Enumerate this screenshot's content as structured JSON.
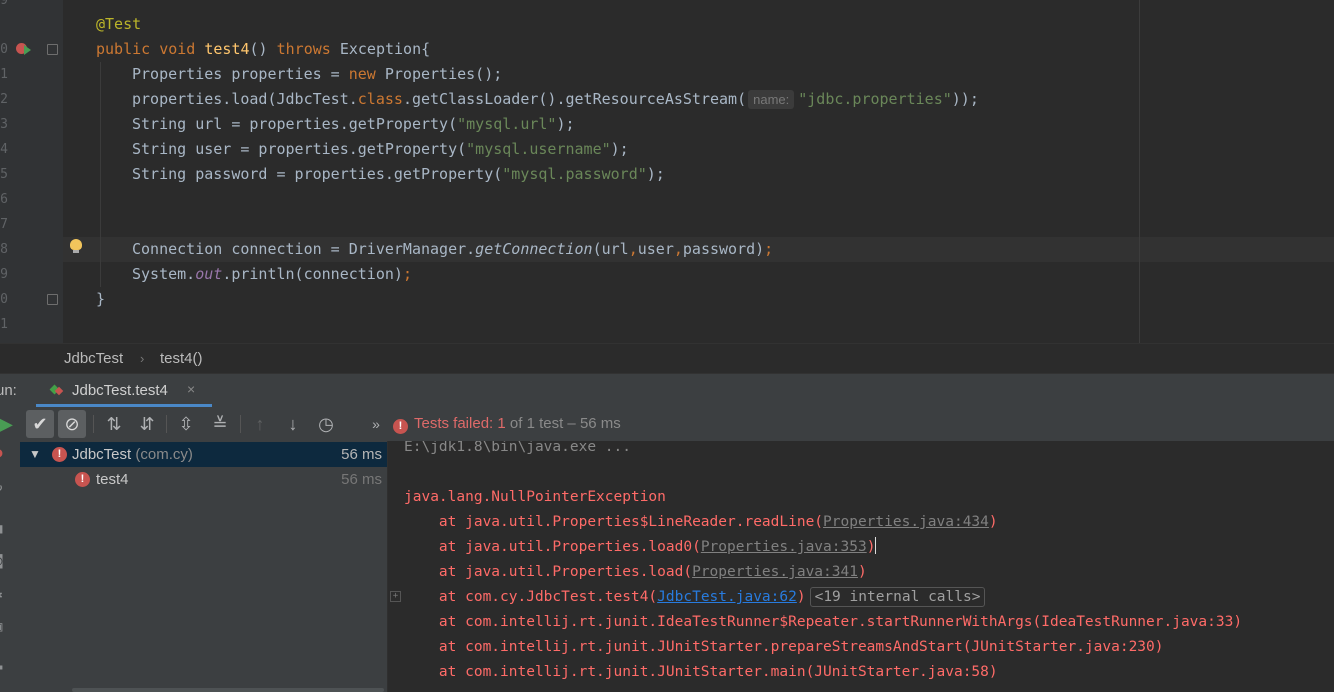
{
  "editor": {
    "line_numbers": [
      "9",
      "0",
      "1",
      "2",
      "3",
      "4",
      "5",
      "6",
      "7",
      "8",
      "9",
      "0",
      "1"
    ],
    "hint_name": "name:",
    "lines": {
      "annotation": "@Test",
      "sig_public": "public",
      "sig_void": "void",
      "sig_method": "test4",
      "sig_parens": "()",
      "sig_throws": "throws",
      "sig_exception": "Exception{",
      "l2_a": "Properties properties = ",
      "l2_new": "new",
      "l2_b": " Properties();",
      "l3_a": "properties.load(JdbcTest.",
      "l3_class": "class",
      "l3_b": ".getClassLoader().getResourceAsStream(",
      "l3_str": "\"jdbc.properties\"",
      "l3_c": "));",
      "l4_a": "String url = properties.getProperty(",
      "l4_str": "\"mysql.url\"",
      "l4_c": ");",
      "l5_a": "String user = properties.getProperty(",
      "l5_str": "\"mysql.username\"",
      "l5_c": ");",
      "l6_a": "String password = properties.getProperty(",
      "l6_str": "\"mysql.password\"",
      "l6_c": ");",
      "l9_a": "Connection connection = DriverManager.",
      "l9_fn": "getConnection",
      "l9_b": "(url",
      "l9_c1": ",",
      "l9_user": "user",
      "l9_c2": ",",
      "l9_pw": "password)",
      "l9_semi": ";",
      "l10_a": "System.",
      "l10_out": "out",
      "l10_b": ".println(connection)",
      "l10_semi": ";",
      "close_brace": "}"
    }
  },
  "breadcrumb": {
    "class_name": "JdbcTest",
    "separator": "›",
    "method": "test4()"
  },
  "run_panel": {
    "label": "un:",
    "tab_title": "JdbcTest.test4",
    "tab_close": "×",
    "status": {
      "failed_text": "Tests failed:",
      "count": " 1",
      "of_text": " of 1 test – 56 ms"
    }
  },
  "test_tree": {
    "root": {
      "name": "JdbcTest",
      "package": "(com.cy)",
      "time": "56 ms"
    },
    "child": {
      "name": "test4",
      "time": "56 ms"
    }
  },
  "console": {
    "command": "E:\\jdk1.8\\bin\\java.exe ...",
    "exception": "java.lang.NullPointerException",
    "frames": [
      {
        "prefix": "    at java.util.Properties$LineReader.readLine(",
        "link": "Properties.java:434",
        "suffix": ")"
      },
      {
        "prefix": "    at java.util.Properties.load0(",
        "link": "Properties.java:353",
        "suffix": ")"
      },
      {
        "prefix": "    at java.util.Properties.load(",
        "link": "Properties.java:341",
        "suffix": ")"
      },
      {
        "prefix": "    at com.cy.JdbcTest.test4(",
        "link": "JdbcTest.java:62",
        "suffix": ")"
      },
      {
        "prefix": "    at com.intellij.rt.junit.IdeaTestRunner$Repeater.startRunnerWithArgs(IdeaTestRunner.java:33)",
        "link": "",
        "suffix": ""
      },
      {
        "prefix": "    at com.intellij.rt.junit.JUnitStarter.prepareStreamsAndStart(JUnitStarter.java:230)",
        "link": "",
        "suffix": ""
      },
      {
        "prefix": "    at com.intellij.rt.junit.JUnitStarter.main(JUnitStarter.java:58)",
        "link": "",
        "suffix": ""
      }
    ],
    "internal_calls": "<19 internal calls>"
  },
  "colors": {
    "accent": "#4a88c7",
    "error": "#c75450",
    "console_error": "#ff6b68",
    "link": "#287bde"
  }
}
